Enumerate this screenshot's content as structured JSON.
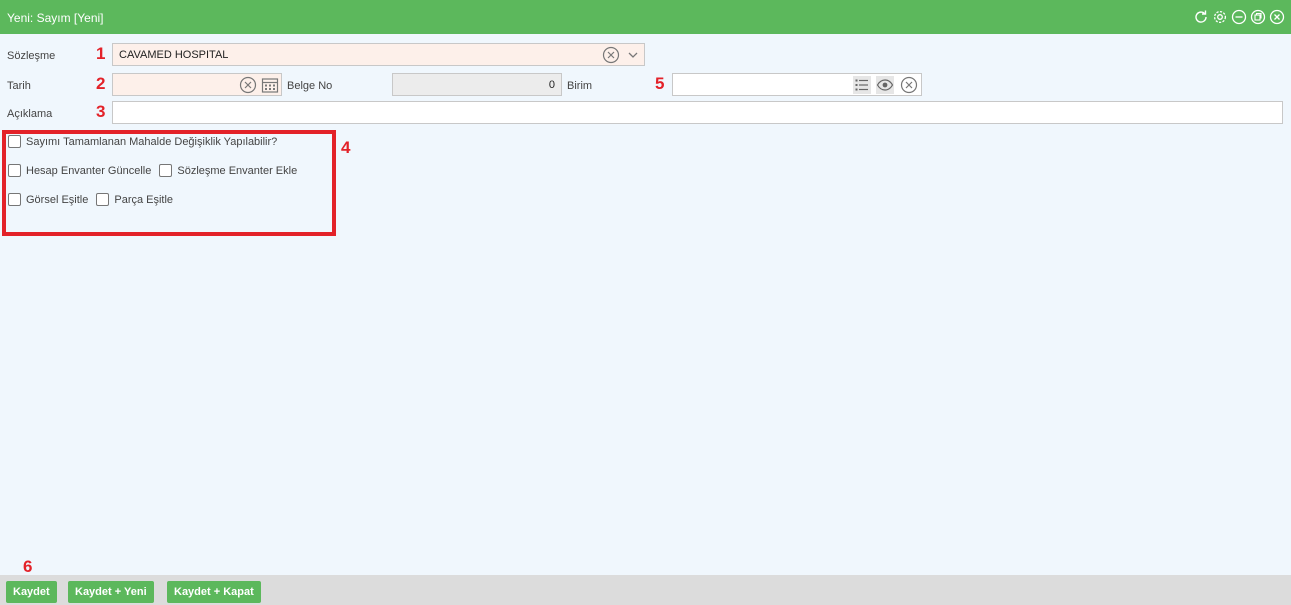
{
  "window": {
    "title": "Yeni: Sayım [Yeni]"
  },
  "window_controls": [
    "refresh-icon",
    "gear-icon",
    "minimize-icon",
    "restore-icon",
    "close-icon"
  ],
  "markers": {
    "m1": "1",
    "m2": "2",
    "m3": "3",
    "m4": "4",
    "m5": "5",
    "m6": "6"
  },
  "form": {
    "contract": {
      "label": "Sözleşme",
      "value": "CAVAMED HOSPITAL"
    },
    "date": {
      "label": "Tarih",
      "value": ""
    },
    "doc_no": {
      "label": "Belge No",
      "value": "0"
    },
    "unit": {
      "label": "Birim",
      "value": ""
    },
    "description": {
      "label": "Açıklama",
      "value": ""
    }
  },
  "options": {
    "allow_change": "Sayımı Tamamlanan Mahalde Değişiklik Yapılabilir?",
    "update_account_inventory": "Hesap Envanter Güncelle",
    "add_contract_inventory": "Sözleşme Envanter Ekle",
    "match_visual": "Görsel Eşitle",
    "match_part": "Parça Eşitle"
  },
  "buttons": {
    "save": "Kaydet",
    "save_new": "Kaydet + Yeni",
    "save_close": "Kaydet + Kapat"
  },
  "colors": {
    "accent": "#5cb85c",
    "highlight": "#e32229",
    "required_bg": "#fdf0ea"
  }
}
